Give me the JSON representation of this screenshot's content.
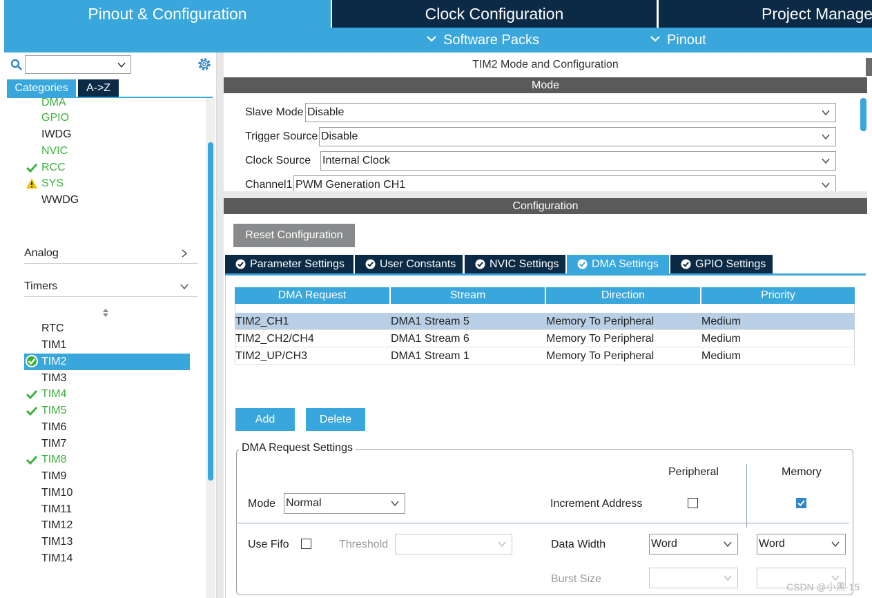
{
  "top_tabs": {
    "pinout": "Pinout & Configuration",
    "clock": "Clock Configuration",
    "project": "Project Manage"
  },
  "sub_bar": {
    "software_packs": "Software Packs",
    "pinout": "Pinout"
  },
  "left": {
    "search_value": "",
    "tabs": {
      "categories": "Categories",
      "az": "A->Z"
    },
    "system_items": [
      {
        "label": "DMA",
        "color": "green",
        "mark": ""
      },
      {
        "label": "GPIO",
        "color": "green",
        "mark": ""
      },
      {
        "label": "IWDG",
        "color": "normal",
        "mark": ""
      },
      {
        "label": "NVIC",
        "color": "green",
        "mark": ""
      },
      {
        "label": "RCC",
        "color": "green",
        "mark": "check"
      },
      {
        "label": "SYS",
        "color": "green",
        "mark": "warning"
      },
      {
        "label": "WWDG",
        "color": "normal",
        "mark": ""
      }
    ],
    "groups": {
      "analog": "Analog",
      "timers": "Timers"
    },
    "timer_items": [
      {
        "label": "RTC",
        "color": "normal",
        "mark": ""
      },
      {
        "label": "TIM1",
        "color": "normal",
        "mark": ""
      },
      {
        "label": "TIM2",
        "color": "selected",
        "mark": "check-circle"
      },
      {
        "label": "TIM3",
        "color": "normal",
        "mark": ""
      },
      {
        "label": "TIM4",
        "color": "green",
        "mark": "check"
      },
      {
        "label": "TIM5",
        "color": "green",
        "mark": "check"
      },
      {
        "label": "TIM6",
        "color": "normal",
        "mark": ""
      },
      {
        "label": "TIM7",
        "color": "normal",
        "mark": ""
      },
      {
        "label": "TIM8",
        "color": "green",
        "mark": "check"
      },
      {
        "label": "TIM9",
        "color": "normal",
        "mark": ""
      },
      {
        "label": "TIM10",
        "color": "normal",
        "mark": ""
      },
      {
        "label": "TIM11",
        "color": "normal",
        "mark": ""
      },
      {
        "label": "TIM12",
        "color": "normal",
        "mark": ""
      },
      {
        "label": "TIM13",
        "color": "normal",
        "mark": ""
      },
      {
        "label": "TIM14",
        "color": "normal",
        "mark": ""
      }
    ]
  },
  "right": {
    "title": "TIM2 Mode and Configuration",
    "mode_header": "Mode",
    "config_header": "Configuration",
    "mode": {
      "slave_mode": {
        "label": "Slave Mode",
        "value": "Disable"
      },
      "trigger_source": {
        "label": "Trigger Source",
        "value": "Disable"
      },
      "clock_source": {
        "label": "Clock Source",
        "value": "Internal Clock"
      },
      "channel1": {
        "label": "Channel1",
        "value": "PWM Generation CH1"
      }
    },
    "reset_button": "Reset Configuration",
    "config_tabs": [
      "Parameter Settings",
      "User Constants",
      "NVIC Settings",
      "DMA Settings",
      "GPIO Settings"
    ],
    "active_tab": "DMA Settings",
    "dma_table": {
      "headers": [
        "DMA Request",
        "Stream",
        "Direction",
        "Priority"
      ],
      "rows": [
        [
          "TIM2_CH1",
          "DMA1 Stream 5",
          "Memory To Peripheral",
          "Medium"
        ],
        [
          "TIM2_CH2/CH4",
          "DMA1 Stream 6",
          "Memory To Peripheral",
          "Medium"
        ],
        [
          "TIM2_UP/CH3",
          "DMA1 Stream 1",
          "Memory To Peripheral",
          "Medium"
        ]
      ],
      "selected_row": 0
    },
    "add_button": "Add",
    "delete_button": "Delete",
    "request_settings": {
      "legend": "DMA Request Settings",
      "peripheral_header": "Peripheral",
      "memory_header": "Memory",
      "mode_label": "Mode",
      "mode_value": "Normal",
      "increment_label": "Increment Address",
      "peripheral_increment": false,
      "memory_increment": true,
      "use_fifo_label": "Use Fifo",
      "use_fifo": false,
      "threshold_label": "Threshold",
      "threshold_value": "",
      "data_width_label": "Data Width",
      "peripheral_width": "Word",
      "memory_width": "Word",
      "burst_size_label": "Burst Size",
      "peripheral_burst": "",
      "memory_burst": ""
    }
  },
  "watermark": "CSDN @小黑-15",
  "colors": {
    "accent": "#39a6dc",
    "dark_tab": "#0b2a45",
    "section_bar": "#5a5a5a",
    "green": "#3bb13b",
    "warning": "#f2c200"
  }
}
